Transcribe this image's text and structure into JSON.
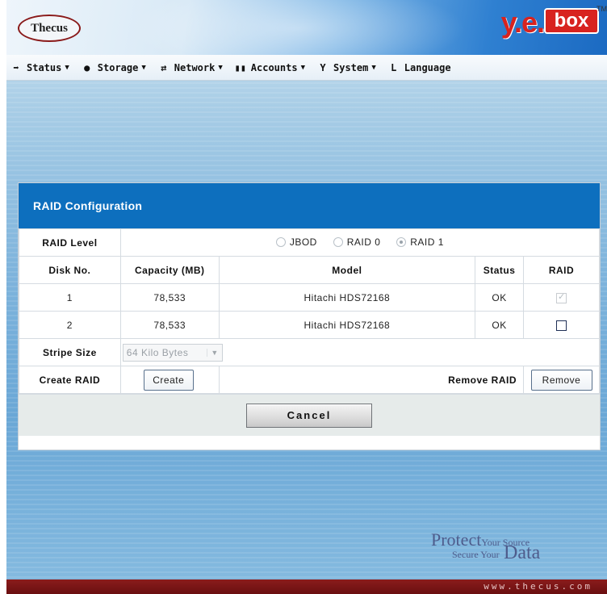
{
  "header": {
    "brand_left": "Thecus",
    "brand_yes": "y.e.s.",
    "brand_box": "box",
    "brand_tm": "TM"
  },
  "menu": [
    {
      "label": "Status",
      "icon": "status-icon",
      "glyph": "➡",
      "caret": "▼"
    },
    {
      "label": "Storage",
      "icon": "storage-icon",
      "glyph": "●",
      "caret": "▼"
    },
    {
      "label": "Network",
      "icon": "network-icon",
      "glyph": "⇄",
      "caret": "▼"
    },
    {
      "label": "Accounts",
      "icon": "accounts-icon",
      "glyph": "▮▮",
      "caret": "▼"
    },
    {
      "label": "System",
      "icon": "system-icon",
      "glyph": "Y",
      "caret": "▼"
    },
    {
      "label": "Language",
      "icon": "language-icon",
      "glyph": "L",
      "caret": ""
    }
  ],
  "panel": {
    "title": "RAID Configuration",
    "raid_level_label": "RAID Level",
    "raid_options": [
      {
        "label": "JBOD",
        "checked": false
      },
      {
        "label": "RAID 0",
        "checked": false
      },
      {
        "label": "RAID 1",
        "checked": true
      }
    ],
    "columns": [
      "Disk No.",
      "Capacity (MB)",
      "Model",
      "Status",
      "RAID"
    ],
    "disks": [
      {
        "no": "1",
        "capacity": "78,533",
        "model": "Hitachi HDS72168",
        "status": "OK",
        "raid_checked": true,
        "raid_disabled": true
      },
      {
        "no": "2",
        "capacity": "78,533",
        "model": "Hitachi HDS72168",
        "status": "OK",
        "raid_checked": false,
        "raid_disabled": false
      }
    ],
    "stripe_size_label": "Stripe Size",
    "stripe_size_value": "64 Kilo Bytes",
    "create_raid_label": "Create RAID",
    "create_button": "Create",
    "remove_raid_label": "Remove RAID",
    "remove_button": "Remove",
    "cancel_button": "Cancel"
  },
  "footer": {
    "slogan_protect": "Protect",
    "slogan_your_source": "Your Source",
    "slogan_secure_your": "Secure Your",
    "slogan_data": "Data",
    "url": "www.thecus.com"
  },
  "colors": {
    "panel_header": "#0d6fbe",
    "brand_red": "#d8231f",
    "footer_bar": "#7a1515"
  }
}
